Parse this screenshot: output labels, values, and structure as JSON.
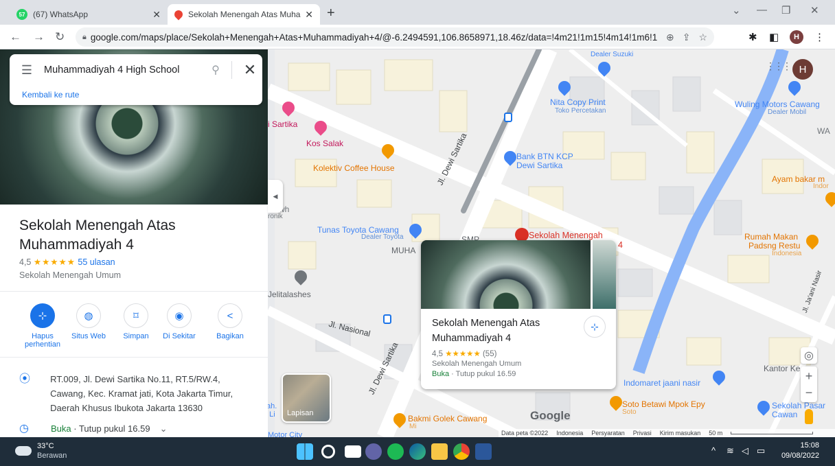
{
  "browser": {
    "tabs": [
      {
        "title": "(67) WhatsApp",
        "badge": "57",
        "active": false
      },
      {
        "title": "Sekolah Menengah Atas Muham",
        "active": true
      }
    ],
    "new_tab": "+",
    "window_controls": [
      "⌄",
      "—",
      "❐",
      "✕"
    ],
    "url": "google.com/maps/place/Sekolah+Menengah+Atas+Muhammadiyah+4/@-6.2494591,106.8658971,18.46z/data=!4m21!1m15!4m14!1m6!1m2!...",
    "profile_initial": "H"
  },
  "panel": {
    "search_query": "Muhammadiyah 4 High School",
    "back_link": "Kembali ke rute",
    "place_name": "Sekolah Menengah Atas Muhammadiyah 4",
    "rating_value": "4,5",
    "stars": "★★★★★",
    "review_count": "55 ulasan",
    "category": "Sekolah Menengah Umum",
    "actions": [
      {
        "label": "Hapus perhentian",
        "icon": "⊹"
      },
      {
        "label": "Situs Web",
        "icon": "◍"
      },
      {
        "label": "Simpan",
        "icon": "⌑"
      },
      {
        "label": "Di Sekitar",
        "icon": "◉"
      },
      {
        "label": "Bagikan",
        "icon": "<"
      }
    ],
    "address": "RT.009, Jl. Dewi Sartika No.11, RT.5/RW.4, Cawang, Kec. Kramat jati, Kota Jakarta Timur, Daerah Khusus Ibukota Jakarta 13630",
    "hours_open": "Buka",
    "hours_text": " · Tutup pukul 16.59",
    "hours_chevron": "⌄"
  },
  "card": {
    "title": "Sekolah Menengah Atas Muhammadiyah 4",
    "rating_value": "4,5",
    "stars": "★★★★★",
    "review_count": "(55)",
    "category": "Sekolah Menengah Umum",
    "open": "Buka",
    "hours": " · Tutup pukul 16.59"
  },
  "map": {
    "labels": {
      "dealer_suzuki": "Dealer Suzuki",
      "nita_copy": "Nita Copy Print",
      "toko_percetakan": "Toko Percetakan",
      "wuling": "Wuling Motors Cawang",
      "dealer_mobil": "Dealer Mobil",
      "wa": "WA",
      "sartika": "i Sartika",
      "kos_salak": "Kos Salak",
      "kolektiv": "Kolektiv Coffee House",
      "jl_dewi_sartika_1": "Jl. Dewi Sartika",
      "bank_btn": "Bank BTN KCP",
      "bank_btn2": "Dewi Sartika",
      "ayam_bakar": "Ayam bakar m",
      "indor": "Indor",
      "swh": "a Swh",
      "onik": "ronik",
      "tunas_toyota": "Tunas Toyota Cawang",
      "dealer_toyota": "Dealer Toyota",
      "muha": "MUHA",
      "smp": "SMP",
      "sekolah_menengah": "Sekolah Menengah",
      "four": "4",
      "rumah_makan": "Rumah Makan",
      "padsng_restu": "Padsng Restu",
      "indonesia": "Indonesia",
      "jelitalashes": "Jelitalashes",
      "jl_nasional": "Jl. Nasional",
      "jl_dewi_sartika_2": "Jl. Dewi Sartika",
      "jaani_nasir": "Jl. Ja'ani Nasir",
      "kantor": "Kantor Ke",
      "indomaret": "Indomaret jaani nasir",
      "soto_betawi": "Soto Betawi Mpok Epy",
      "soto": "Soto",
      "sekolah_pasar": "Sekolah Pasar",
      "cawang_pa": "Cawan",
      "bakmi": "Bakmi Golek Cawang",
      "mi": "Mi",
      "motor_city": "Motor City",
      "ah": "ah.",
      "li": "t Li",
      "google": "Google"
    },
    "layers_label": "Lapisan",
    "footer": [
      "Data peta ©2022",
      "Indonesia",
      "Persyaratan",
      "Privasi",
      "Kirim masukan",
      "50 m"
    ],
    "apps_icon": "⋮⋮⋮",
    "profile_initial": "H"
  },
  "taskbar": {
    "temperature": "33°C",
    "condition": "Berawan",
    "time": "15:08",
    "date": "09/08/2022",
    "tray_icons": [
      "^",
      "≋",
      "◁",
      "▭"
    ]
  }
}
